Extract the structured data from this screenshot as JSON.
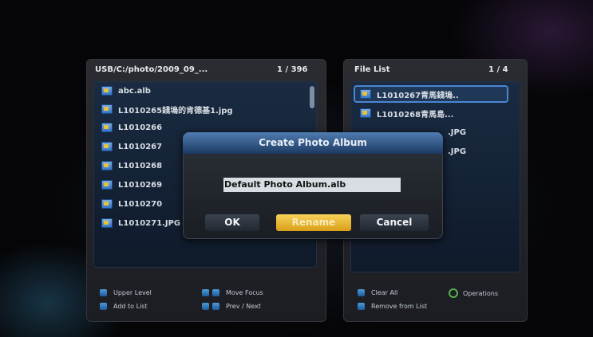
{
  "left_panel": {
    "path": "USB/C:/photo/2009_09_...",
    "counter": "1 / 396",
    "items": [
      "abc.alb",
      "L1010265錢塢的肯德基1.jpg",
      "L1010266",
      "L1010267",
      "L1010268",
      "L1010269",
      "L1010270",
      "L1010271.JPG"
    ]
  },
  "right_panel": {
    "title": "File List",
    "counter": "1 / 4",
    "items": [
      "L1010267青馬錢塢..",
      "L1010268青馬島...",
      ".JPG",
      ".JPG"
    ]
  },
  "legend": {
    "upper_level": "Upper Level",
    "add_to_list": "Add to List",
    "move_focus": "Move Focus",
    "prev_next": "Prev / Next",
    "clear_all": "Clear All",
    "operations": "Operations",
    "remove_from_list": "Remove from List"
  },
  "dialog": {
    "title": "Create Photo Album",
    "input_value": "Default Photo Album.alb",
    "ok": "OK",
    "rename": "Rename",
    "cancel": "Cancel"
  },
  "colors": {
    "accent": "#4a86d3",
    "rename_button": "#f0c13a",
    "dialog_title": "#3e6aa0"
  }
}
